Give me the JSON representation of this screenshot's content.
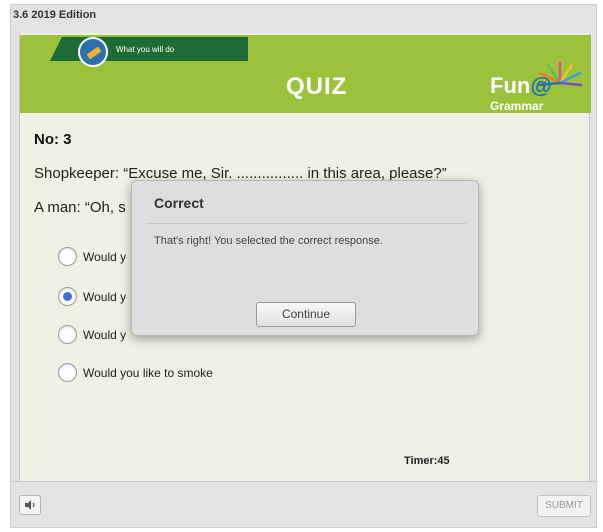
{
  "app": {
    "edition": "3.6 2019 Edition"
  },
  "banner": {
    "ribbon_label": "What you will do",
    "title": "QUIZ",
    "logo_main": "Fun",
    "logo_at": "@",
    "logo_sub": "Grammar"
  },
  "question": {
    "number": "No: 3",
    "line1": "Shopkeeper: “Excuse me, Sir. ................ in this area, please?”",
    "line2": "A man: “Oh, s"
  },
  "options": [
    {
      "text": "Would y",
      "selected": false
    },
    {
      "text": "Would y",
      "selected": true
    },
    {
      "text": "Would y",
      "selected": false
    },
    {
      "text": "Would you like to smoke",
      "selected": false
    }
  ],
  "timer": "Timer:45",
  "footer": {
    "submit_label": "SUBMIT",
    "sound_icon": "speaker-icon"
  },
  "dialog": {
    "title": "Correct",
    "message": "That's right!  You selected the correct response.",
    "button_label": "Continue"
  },
  "colors": {
    "banner": "#9cc23c",
    "ribbon": "#1f6b35",
    "stage": "#eef1e3",
    "radio_selected": "#3d6fd8"
  }
}
